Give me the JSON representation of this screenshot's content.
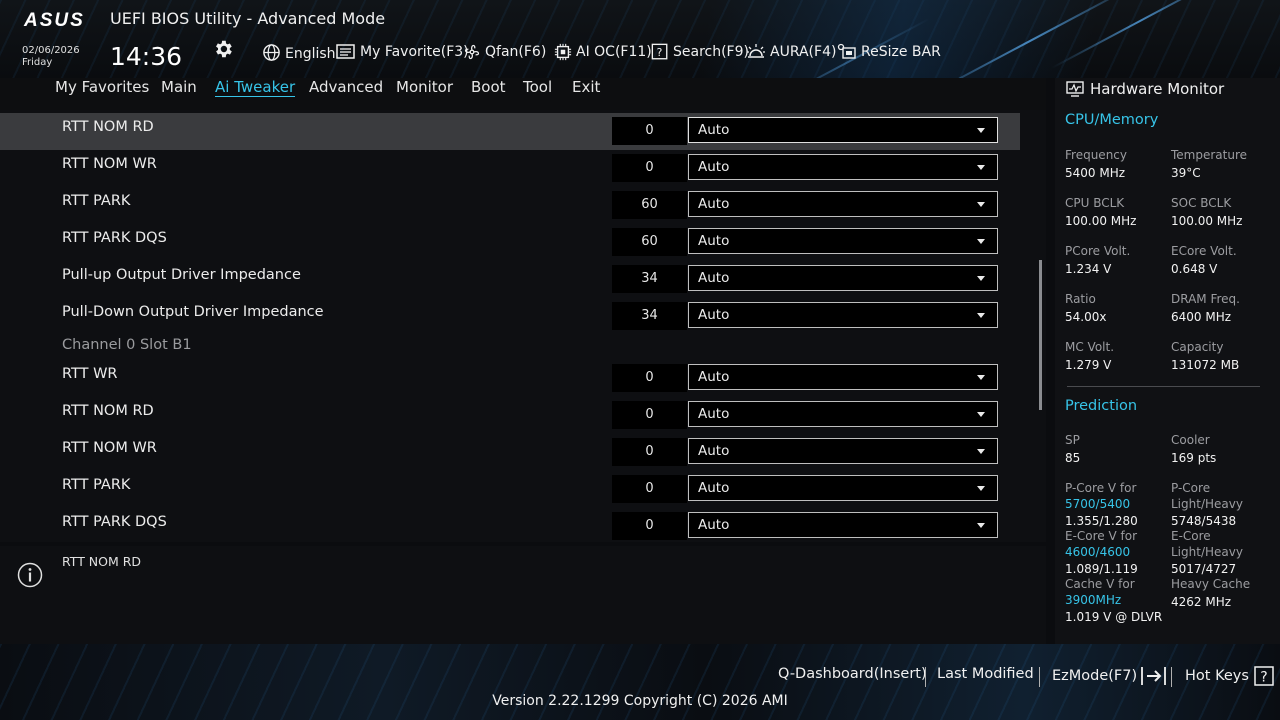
{
  "header": {
    "logo": "ASUS",
    "title": "UEFI BIOS Utility - Advanced Mode",
    "date": "02/06/2026",
    "day": "Friday",
    "time": "14:36",
    "toolbar": [
      {
        "label": "English",
        "icon": "globe-icon"
      },
      {
        "label": "My Favorite(F3)",
        "icon": "favorite-icon"
      },
      {
        "label": "Qfan(F6)",
        "icon": "fan-icon"
      },
      {
        "label": "AI OC(F11)",
        "icon": "ai-oc-icon"
      },
      {
        "label": "Search(F9)",
        "icon": "search-help-icon"
      },
      {
        "label": "AURA(F4)",
        "icon": "aura-icon"
      },
      {
        "label": "ReSize BAR",
        "icon": "resize-bar-icon"
      }
    ]
  },
  "nav": {
    "tabs": [
      "My Favorites",
      "Main",
      "Ai Tweaker",
      "Advanced",
      "Monitor",
      "Boot",
      "Tool",
      "Exit"
    ],
    "active": "Ai Tweaker"
  },
  "settings": {
    "rows": [
      {
        "label": "RTT NOM RD",
        "value": "0",
        "option": "Auto"
      },
      {
        "label": "RTT NOM WR",
        "value": "0",
        "option": "Auto"
      },
      {
        "label": "RTT PARK",
        "value": "60",
        "option": "Auto"
      },
      {
        "label": "RTT PARK DQS",
        "value": "60",
        "option": "Auto"
      },
      {
        "label": "Pull-up Output Driver Impedance",
        "value": "34",
        "option": "Auto"
      },
      {
        "label": "Pull-Down Output Driver Impedance",
        "value": "34",
        "option": "Auto"
      },
      {
        "label": "RTT WR",
        "value": "0",
        "option": "Auto"
      },
      {
        "label": "RTT NOM RD",
        "value": "0",
        "option": "Auto"
      },
      {
        "label": "RTT NOM WR",
        "value": "0",
        "option": "Auto"
      },
      {
        "label": "RTT PARK",
        "value": "0",
        "option": "Auto"
      },
      {
        "label": "RTT PARK DQS",
        "value": "0",
        "option": "Auto"
      }
    ],
    "section": "Channel 0 Slot B1"
  },
  "info": {
    "text": "RTT NOM RD"
  },
  "hw_monitor": {
    "title": "Hardware Monitor",
    "cpu_section": "CPU/Memory",
    "cpu": [
      {
        "label": "Frequency",
        "value": "5400 MHz"
      },
      {
        "label": "Temperature",
        "value": "39°C"
      },
      {
        "label": "CPU BCLK",
        "value": "100.00 MHz"
      },
      {
        "label": "SOC BCLK",
        "value": "100.00 MHz"
      },
      {
        "label": "PCore Volt.",
        "value": "1.234 V"
      },
      {
        "label": "ECore Volt.",
        "value": "0.648 V"
      },
      {
        "label": "Ratio",
        "value": "54.00x"
      },
      {
        "label": "DRAM Freq.",
        "value": "6400 MHz"
      },
      {
        "label": "MC Volt.",
        "value": "1.279 V"
      },
      {
        "label": "Capacity",
        "value": "131072 MB"
      }
    ],
    "prediction_section": "Prediction",
    "prediction": {
      "sp_label": "SP",
      "sp_value": "85",
      "cooler_label": "Cooler",
      "cooler_value": "169 pts",
      "pcore_label": "P-Core V for",
      "pcore_freq": "5700/5400",
      "pcore_value": "1.355/1.280",
      "pcore_lh_label1": "P-Core",
      "pcore_lh_label2": "Light/Heavy",
      "pcore_lh_value": "5748/5438",
      "ecore_label": "E-Core V for",
      "ecore_freq": "4600/4600",
      "ecore_value": "1.089/1.119",
      "ecore_lh_label1": "E-Core",
      "ecore_lh_label2": "Light/Heavy",
      "ecore_lh_value": "5017/4727",
      "cache_label": "Cache V for",
      "cache_freq": "3900MHz",
      "cache_value": "1.019 V @ DLVR",
      "heavy_cache_label": "Heavy Cache",
      "heavy_cache_value": "4262 MHz"
    }
  },
  "footer": {
    "qdashboard": "Q-Dashboard(Insert)",
    "last_modified": "Last Modified",
    "ezmode": "EzMode(F7)",
    "hotkeys": "Hot Keys",
    "version": "Version 2.22.1299 Copyright (C) 2026 AMI"
  },
  "colors": {
    "accent": "#37c4e8",
    "background": "#0b0c0f",
    "selected_row": "#3a3b3e"
  }
}
